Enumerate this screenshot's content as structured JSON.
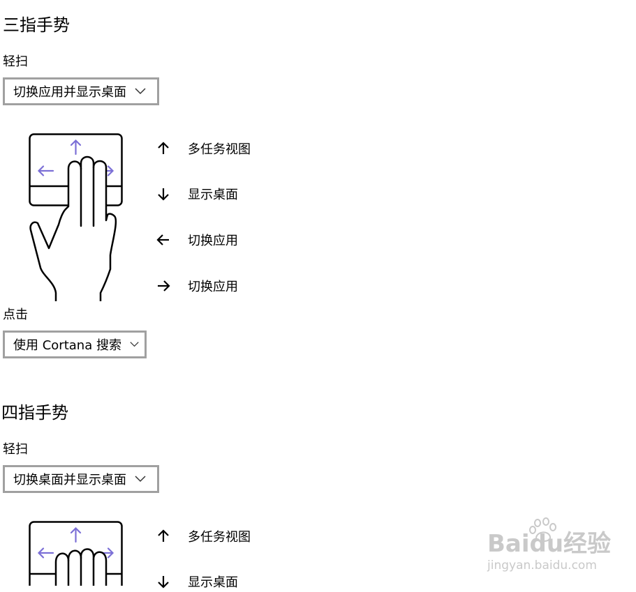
{
  "three_finger": {
    "title": "三指手势",
    "swipe_label": "轻扫",
    "swipe_value": "切换应用并显示桌面",
    "legend": [
      {
        "icon": "arrow-up-icon",
        "text": "多任务视图"
      },
      {
        "icon": "arrow-down-icon",
        "text": "显示桌面"
      },
      {
        "icon": "arrow-left-icon",
        "text": "切换应用"
      },
      {
        "icon": "arrow-right-icon",
        "text": "切换应用"
      }
    ],
    "tap_label": "点击",
    "tap_value": "使用 Cortana 搜索"
  },
  "four_finger": {
    "title": "四指手势",
    "swipe_label": "轻扫",
    "swipe_value": "切换桌面并显示桌面",
    "legend": [
      {
        "icon": "arrow-up-icon",
        "text": "多任务视图"
      },
      {
        "icon": "arrow-down-icon",
        "text": "显示桌面"
      }
    ]
  },
  "watermark": {
    "brand": "Baidu经验",
    "url": "jingyan.baidu.com"
  },
  "colors": {
    "accent_arrow": "#7b6fd6",
    "dropdown_border": "#a0a0a0",
    "watermark": "#c9c9c9"
  }
}
